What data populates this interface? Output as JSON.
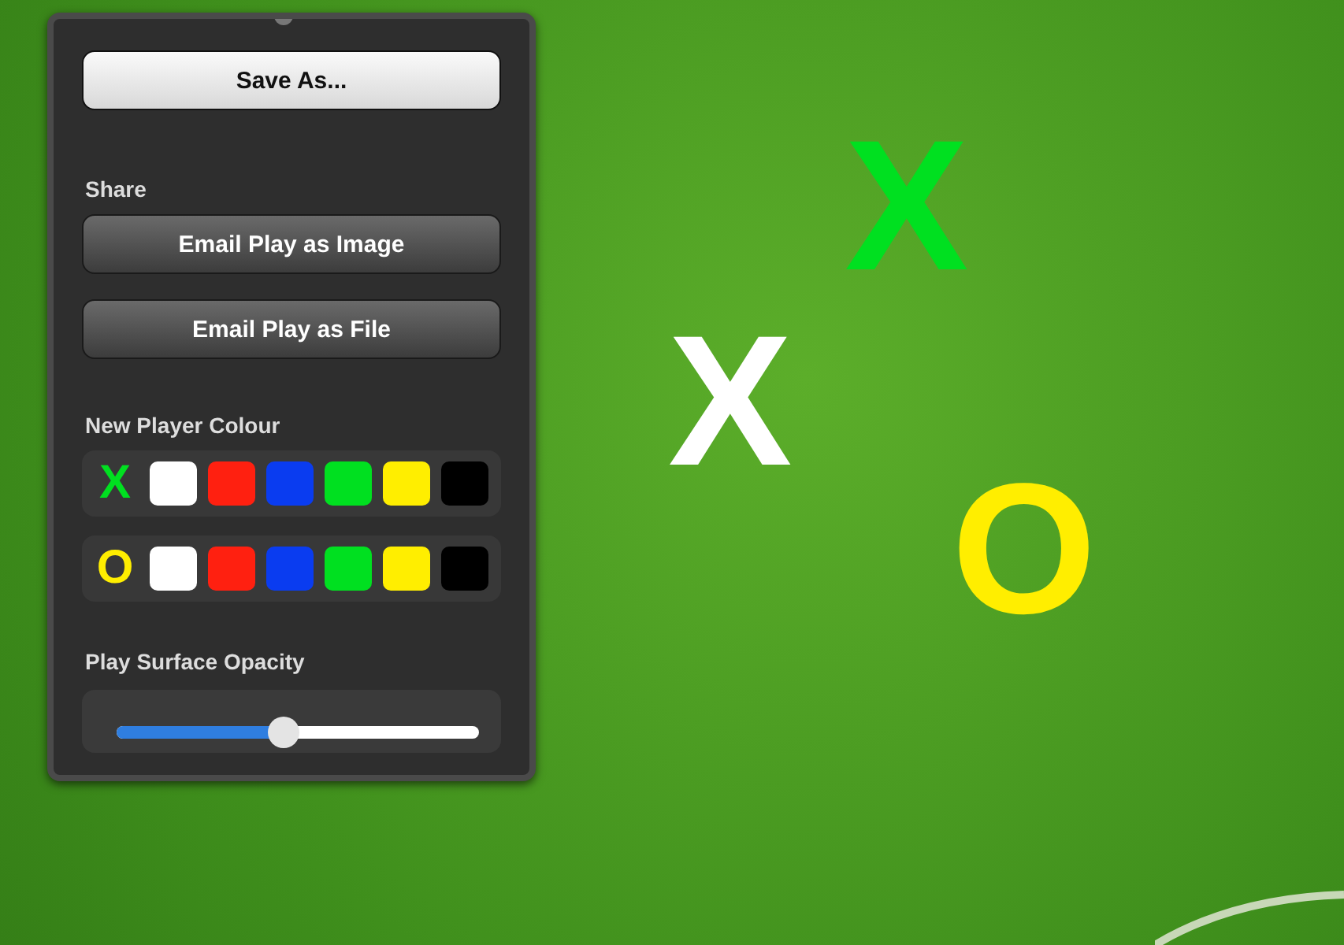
{
  "popover": {
    "save_button": "Save As...",
    "share_label": "Share",
    "share_buttons": [
      "Email Play as Image",
      "Email Play as File"
    ],
    "colour_label": "New Player Colour",
    "players": [
      {
        "symbol": "X",
        "color": "#00e020",
        "swatches": [
          {
            "color": "#ffffff"
          },
          {
            "color": "#ff2010"
          },
          {
            "color": "#0a3cf0"
          },
          {
            "color": "#00e020"
          },
          {
            "color": "#ffee00"
          },
          {
            "color": "#000000"
          }
        ]
      },
      {
        "symbol": "O",
        "color": "#ffee00",
        "swatches": [
          {
            "color": "#ffffff"
          },
          {
            "color": "#ff2010"
          },
          {
            "color": "#0a3cf0"
          },
          {
            "color": "#00e020"
          },
          {
            "color": "#ffee00"
          },
          {
            "color": "#000000"
          }
        ]
      }
    ],
    "opacity_label": "Play Surface Opacity",
    "opacity": {
      "level": 0.46
    }
  },
  "board": {
    "marks": [
      {
        "symbol": "X",
        "color": "#00e020"
      },
      {
        "symbol": "X",
        "color": "#ffffff"
      },
      {
        "symbol": "O",
        "color": "#ffee00"
      }
    ]
  }
}
